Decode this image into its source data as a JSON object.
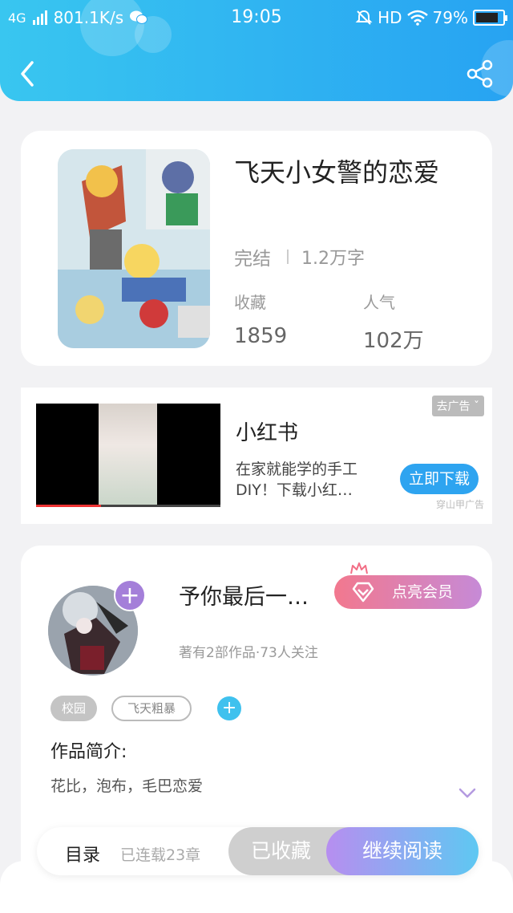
{
  "status_bar": {
    "network": "4G",
    "speed": "801.1K/s",
    "time": "19:05",
    "hd": "HD",
    "battery": "79%"
  },
  "book": {
    "title": "飞天小女警的恋爱",
    "status": "完结",
    "word_count": "1.2万字",
    "favorites_label": "收藏",
    "favorites_value": "1859",
    "popularity_label": "人气",
    "popularity_value": "102万"
  },
  "ad": {
    "remove_label": "去广告",
    "title": "小红书",
    "description": "在家就能学的手工DIY！下载小红…",
    "button_label": "立即下载",
    "source": "穿山甲广告"
  },
  "author": {
    "name": "予你最后一…",
    "vip_label": "点亮会员",
    "stats": "著有2部作品·73人关注",
    "tags": [
      "校园",
      "飞天粗暴"
    ],
    "intro_label": "作品简介:",
    "intro_text": "花比，泡布，毛巴恋爱"
  },
  "bottom": {
    "toc_label": "目录",
    "serial_label": "已连载23章",
    "favorited_label": "已收藏",
    "read_label": "继续阅读"
  },
  "colors": {
    "header_start": "#39c6f0",
    "header_end": "#27a3f2",
    "accent_blue": "#2ea4f0",
    "accent_purple": "#a47fd9"
  }
}
